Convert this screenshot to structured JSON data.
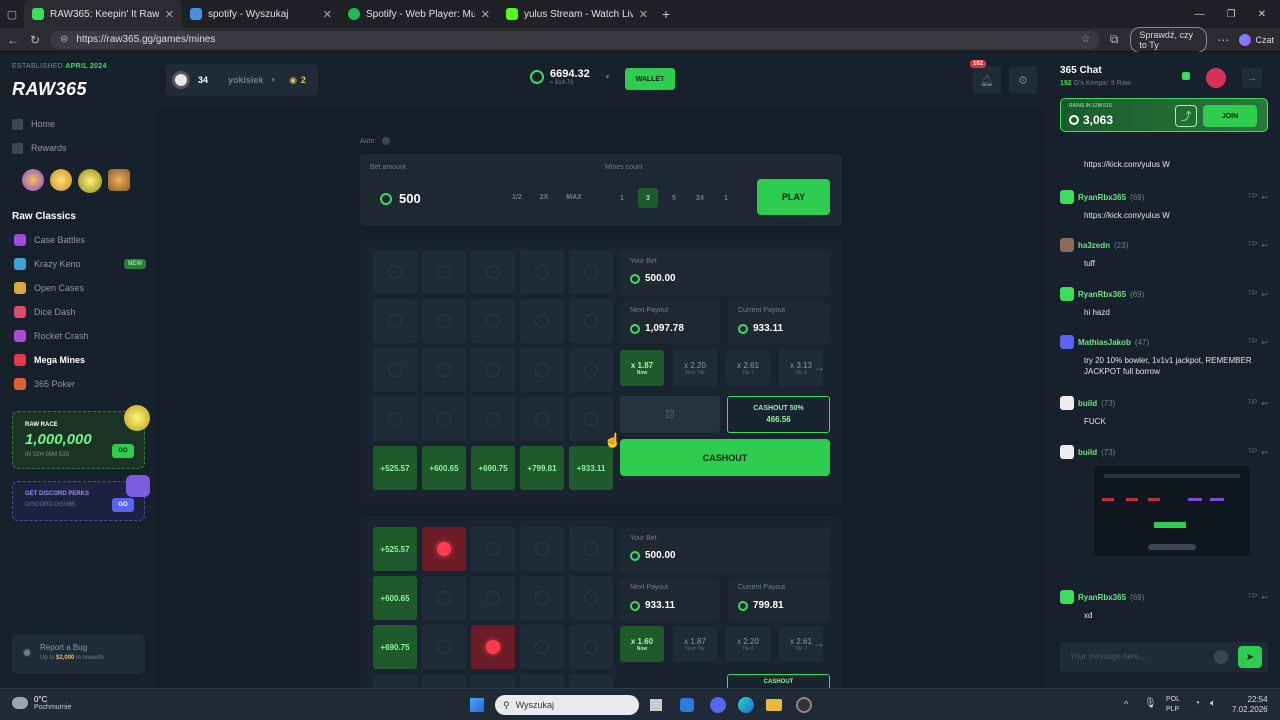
{
  "browser": {
    "tabs": [
      {
        "label": "RAW365: Keepin' It Raw",
        "color": "#3ddc5c"
      },
      {
        "label": "spotify - Wyszukaj",
        "color": "#4a90e2"
      },
      {
        "label": "Spotify - Web Player: Music for ev",
        "color": "#1db954"
      },
      {
        "label": "yulus Stream - Watch Live on Kick",
        "color": "#53fc18"
      }
    ],
    "url": "https://raw365.gg/games/mines",
    "check_pill": "Sprawdź, czy to Ty",
    "profile_label": "Czat"
  },
  "sidebar": {
    "established_prefix": "ESTABLISHED",
    "established_date": "APRIL 2024",
    "logo": "RAW365",
    "nav": [
      {
        "label": "Home",
        "icon": "home-icon"
      },
      {
        "label": "Rewards",
        "icon": "gift-icon"
      }
    ],
    "section_title": "Raw Classics",
    "modes": [
      {
        "label": "Case Battles",
        "color": "#a04ad8",
        "active": false
      },
      {
        "label": "Krazy Keno",
        "color": "#3fa3d8",
        "badge": "NEW",
        "active": false
      },
      {
        "label": "Open Cases",
        "color": "#d8a53f",
        "active": false
      },
      {
        "label": "Dice Dash",
        "color": "#e04a6a",
        "active": false
      },
      {
        "label": "Rocket Crash",
        "color": "#b04ad8",
        "active": false
      },
      {
        "label": "Mega Mines",
        "color": "#e03a4a",
        "active": true
      },
      {
        "label": "365 Poker",
        "color": "#e0603a",
        "active": false
      }
    ],
    "race": {
      "title": "RAW RACE",
      "amount": "1,000,000",
      "timer": "IN 02H 05M 53S",
      "go": "GO"
    },
    "discord": {
      "title": "GET DISCORD PERKS",
      "link": "DISCORD.GG/365",
      "go": "GO"
    },
    "bug": {
      "title": "Report a Bug",
      "sub_prefix": "Up to",
      "sub_amount": "$2,000",
      "sub_suffix": "in rewards"
    }
  },
  "topbar": {
    "level": "34",
    "username": "yokisiek",
    "coins": "2",
    "balance": "6694.32",
    "balance_usd": "≈ $14.73",
    "wallet": "WALLET",
    "notifications": "102"
  },
  "game": {
    "auto_label": "Auto:",
    "bet_label": "Bet amount",
    "bet_value": "500",
    "bet_controls": [
      "1/2",
      "2X",
      "MAX"
    ],
    "mines_label": "Mines count",
    "mines_options": [
      "1",
      "3",
      "5",
      "24",
      "1"
    ],
    "play": "PLAY",
    "round1": {
      "your_bet_label": "Your Bet",
      "your_bet": "500.00",
      "next_payout_label": "Next Payout",
      "next_payout": "1,097.78",
      "current_payout_label": "Current Payout",
      "current_payout": "933.11",
      "multipliers": [
        {
          "v": "x 1.87",
          "s": "Now"
        },
        {
          "v": "x 2.20",
          "s": "Next Tile"
        },
        {
          "v": "x 2.61",
          "s": "Tile 7"
        },
        {
          "v": "x 3.13",
          "s": "Tile 8"
        }
      ],
      "cashout_half_label": "CASHOUT 50%",
      "cashout_half_value": "466.56",
      "cashout": "CASHOUT",
      "wins": [
        "+525.57",
        "+600.65",
        "+690.75",
        "+799.81",
        "+933.11"
      ]
    },
    "round2": {
      "your_bet_label": "Your Bet",
      "your_bet": "500.00",
      "next_payout_label": "Next Payout",
      "next_payout": "933.11",
      "current_payout_label": "Current Payout",
      "current_payout": "799.81",
      "multipliers": [
        {
          "v": "x 1.60",
          "s": "Now"
        },
        {
          "v": "x 1.87",
          "s": "Next Tile"
        },
        {
          "v": "x 2.20",
          "s": "Tile 6"
        },
        {
          "v": "x 2.61",
          "s": "Tile 7"
        }
      ],
      "wins": [
        "+525.57",
        "+600.65",
        "+690.75"
      ],
      "cashout_partial": "CASHOUT"
    }
  },
  "chat": {
    "title": "365 Chat",
    "online": "192",
    "tagline": "G's Keepin' It Raw",
    "rain_label": "RAINS IN 12M 51S",
    "rain_amount": "3,063",
    "join": "JOIN",
    "first_line": "https://kick.com/yulus W",
    "messages": [
      {
        "name": "RyanRbx365",
        "lvl": "(69)",
        "text": "https://kick.com/yulus W",
        "color": "#3ddc5c"
      },
      {
        "name": "ha3zedn",
        "lvl": "(23)",
        "text": "tuff",
        "color": "#8a6a5a"
      },
      {
        "name": "RyanRbx365",
        "lvl": "(69)",
        "text": "hi hazd",
        "color": "#3ddc5c"
      },
      {
        "name": "MathiasJakob",
        "lvl": "(47)",
        "text": "try 20 10% bowler, 1v1v1 jackpot, REMEMBER JACKPOT full borrow",
        "color": "#5865f2"
      },
      {
        "name": "build",
        "lvl": "(73)",
        "text": "FUCK",
        "color": "#eeeeee"
      },
      {
        "name": "build",
        "lvl": "(73)",
        "text": "",
        "color": "#eeeeee"
      },
      {
        "name": "RyanRbx365",
        "lvl": "(69)",
        "text": "xd",
        "color": "#3ddc5c"
      }
    ],
    "tip": "TIP",
    "input_placeholder": "Your message here..."
  },
  "taskbar": {
    "weather_temp": "0°C",
    "weather_desc": "Pochmurnie",
    "search": "Wyszukaj",
    "lang1": "POL",
    "lang2": "PLP",
    "time": "22:54",
    "date": "7.02.2026"
  }
}
